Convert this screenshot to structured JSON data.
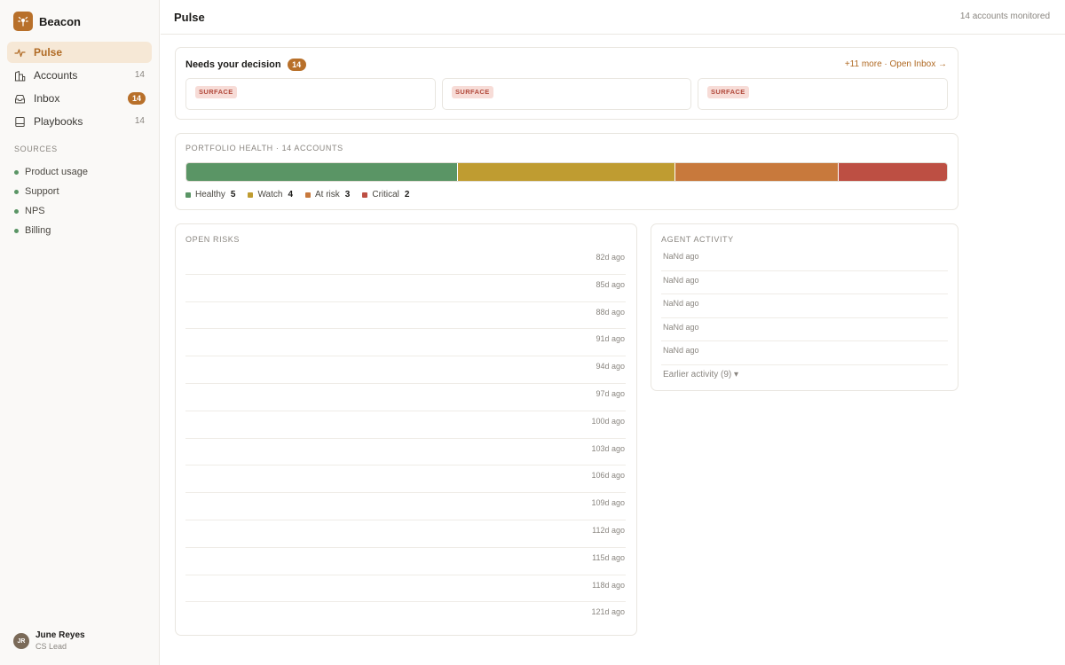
{
  "brand": {
    "name": "Beacon",
    "logo_color": "#b8702a"
  },
  "sidebar": {
    "nav": [
      {
        "label": "Pulse",
        "icon": "pulse-icon",
        "active": true
      },
      {
        "label": "Accounts",
        "icon": "buildings-icon",
        "count": "14"
      },
      {
        "label": "Inbox",
        "icon": "inbox-icon",
        "badge": "14"
      },
      {
        "label": "Playbooks",
        "icon": "book-icon",
        "count": "14"
      }
    ],
    "sources_title": "SOURCES",
    "sources": [
      "Product usage",
      "Support",
      "NPS",
      "Billing"
    ],
    "user": {
      "initials": "JR",
      "name": "June Reyes",
      "role": "CS Lead"
    }
  },
  "header": {
    "title": "Pulse",
    "meta": "14 accounts monitored"
  },
  "decision": {
    "title": "Needs your decision",
    "badge": "14",
    "more": "+11 more · Open Inbox →",
    "cards": [
      {
        "tag": "SURFACE"
      },
      {
        "tag": "SURFACE"
      },
      {
        "tag": "SURFACE"
      }
    ]
  },
  "health": {
    "label": "PORTFOLIO HEALTH · 14 ACCOUNTS",
    "segments": [
      {
        "label": "Healthy",
        "count": "5",
        "value": 5,
        "color": "#5a9565"
      },
      {
        "label": "Watch",
        "count": "4",
        "value": 4,
        "color": "#bf9c31"
      },
      {
        "label": "At risk",
        "count": "3",
        "value": 3,
        "color": "#c8793c"
      },
      {
        "label": "Critical",
        "count": "2",
        "value": 2,
        "color": "#bd4f43"
      }
    ]
  },
  "risks": {
    "label": "OPEN RISKS",
    "rows": [
      "82d ago",
      "85d ago",
      "88d ago",
      "91d ago",
      "94d ago",
      "97d ago",
      "100d ago",
      "103d ago",
      "106d ago",
      "109d ago",
      "112d ago",
      "115d ago",
      "118d ago",
      "121d ago"
    ]
  },
  "activity": {
    "label": "AGENT ACTIVITY",
    "rows": [
      "NaNd ago",
      "NaNd ago",
      "NaNd ago",
      "NaNd ago",
      "NaNd ago"
    ],
    "earlier": "Earlier activity (9) ▾"
  }
}
